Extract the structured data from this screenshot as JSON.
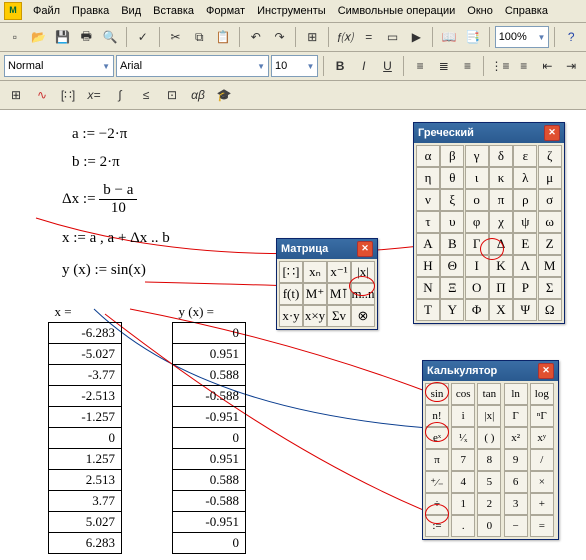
{
  "menu": {
    "items": [
      "Файл",
      "Правка",
      "Вид",
      "Вставка",
      "Формат",
      "Инструменты",
      "Символьные операции",
      "Окно",
      "Справка"
    ]
  },
  "toolbar": {
    "style_select": "Normal",
    "font_select": "Arial",
    "size_select": "10",
    "zoom": "100%",
    "icons": [
      "new",
      "open",
      "save",
      "print",
      "preview",
      "spell",
      "cut",
      "copy",
      "paste",
      "undo",
      "redo",
      "align-node",
      "fx",
      "equal",
      "component",
      "go",
      "bold",
      "italic",
      "underline",
      "align-left",
      "align-center",
      "align-right",
      "bullets",
      "numbers",
      "indent-out",
      "indent-in",
      "help"
    ],
    "math_tb": [
      "calc",
      "graph",
      "matrix-tb",
      "xeq",
      "bracket-int",
      "integral-sigma",
      "less-greater",
      "alpha-beta",
      "cap"
    ]
  },
  "equations": {
    "a": "a := −2·π",
    "b": "b := 2·π",
    "dx_lhs": "Δx :=",
    "dx_num": "b − a",
    "dx_den": "10",
    "x": "x := a , a + Δx .. b",
    "y": "y (x) := sin(x)"
  },
  "tables": {
    "x": {
      "header": "x =",
      "rows": [
        "-6.283",
        "-5.027",
        "-3.77",
        "-2.513",
        "-1.257",
        "0",
        "1.257",
        "2.513",
        "3.77",
        "5.027",
        "6.283"
      ]
    },
    "y": {
      "header": "y (x) =",
      "rows": [
        "0",
        "0.951",
        "0.588",
        "-0.588",
        "-0.951",
        "0",
        "0.951",
        "0.588",
        "-0.588",
        "-0.951",
        "0"
      ]
    }
  },
  "palettes": {
    "matrix": {
      "title": "Матрица",
      "cells": [
        "[∷]",
        "xₙ",
        "x⁻¹",
        "|x|",
        "f(t)",
        "M⁺",
        "M⊺",
        "m..n",
        "x·y",
        "x×y",
        "Σv",
        "⊗"
      ]
    },
    "greek": {
      "title": "Греческий",
      "cells": [
        "α",
        "β",
        "γ",
        "δ",
        "ε",
        "ζ",
        "η",
        "θ",
        "ι",
        "κ",
        "λ",
        "μ",
        "ν",
        "ξ",
        "ο",
        "π",
        "ρ",
        "σ",
        "τ",
        "υ",
        "φ",
        "χ",
        "ψ",
        "ω",
        "Α",
        "Β",
        "Γ",
        "Δ",
        "Ε",
        "Ζ",
        "Η",
        "Θ",
        "Ι",
        "Κ",
        "Λ",
        "Μ",
        "Ν",
        "Ξ",
        "Ο",
        "Π",
        "Ρ",
        "Σ",
        "Τ",
        "Υ",
        "Φ",
        "Χ",
        "Ψ",
        "Ω"
      ]
    },
    "calc": {
      "title": "Калькулятор",
      "cells": [
        "sin",
        "cos",
        "tan",
        "ln",
        "log",
        "n!",
        "i",
        "|x|",
        "Γ",
        "ⁿΓ",
        "eˣ",
        "¹⁄ₓ",
        "( )",
        "x²",
        "xʸ",
        "π",
        "7",
        "8",
        "9",
        "/",
        "⁺⁄₋",
        "4",
        "5",
        "6",
        "×",
        "÷",
        "1",
        "2",
        "3",
        "+",
        ":=",
        ".",
        "0",
        "−",
        "="
      ]
    }
  },
  "chart_data": {
    "type": "table",
    "series": [
      {
        "name": "x",
        "values": [
          -6.283,
          -5.027,
          -3.77,
          -2.513,
          -1.257,
          0,
          1.257,
          2.513,
          3.77,
          5.027,
          6.283
        ]
      },
      {
        "name": "y(x)=sin(x)",
        "values": [
          0,
          0.951,
          0.588,
          -0.588,
          -0.951,
          0,
          0.951,
          0.588,
          -0.588,
          -0.951,
          0
        ]
      }
    ]
  }
}
